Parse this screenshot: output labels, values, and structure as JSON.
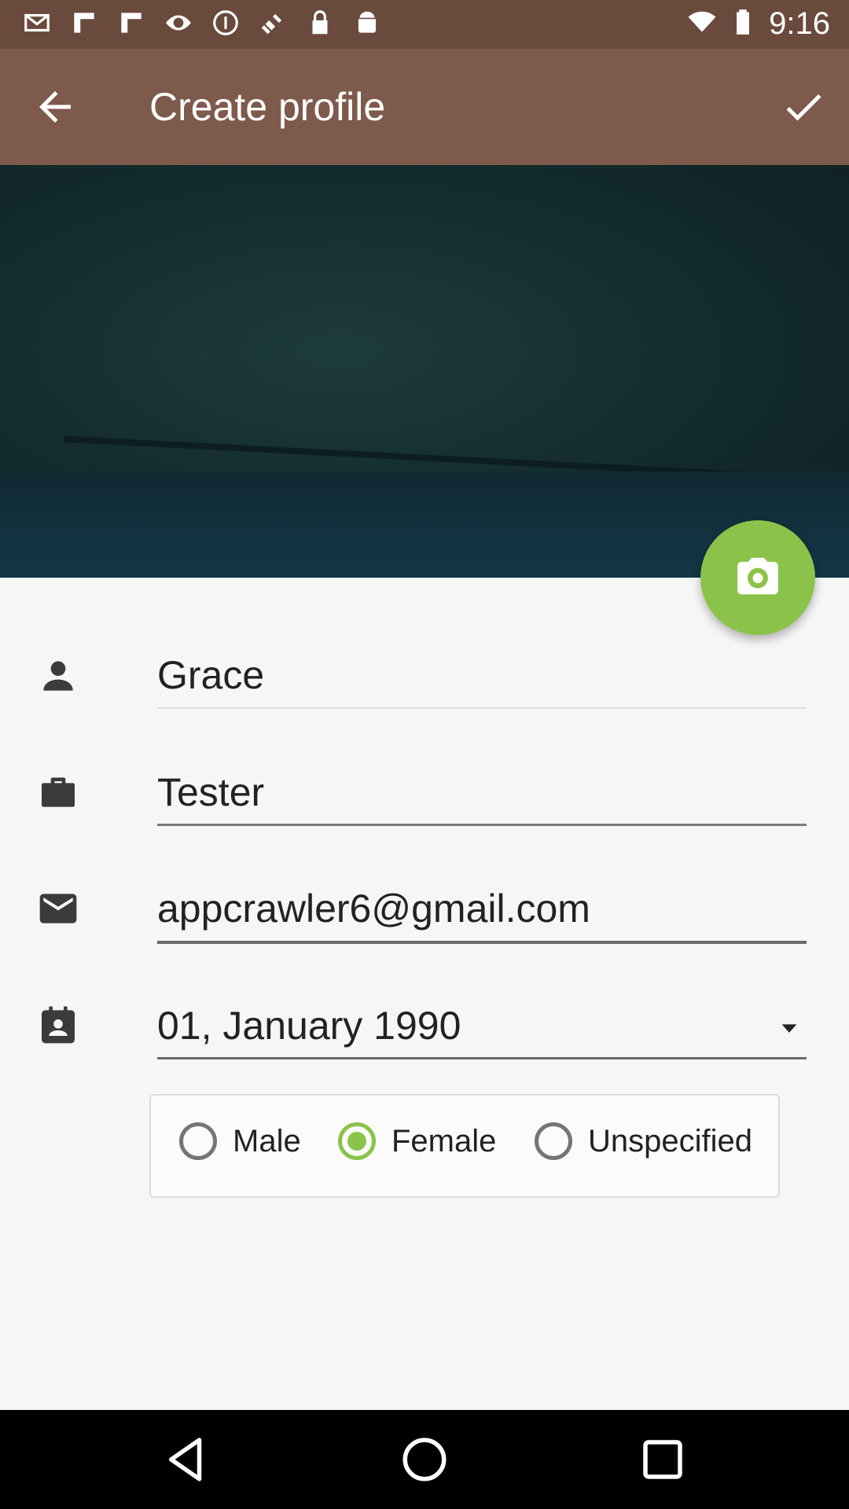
{
  "status_bar": {
    "time": "9:16",
    "icons": [
      "mail-icon",
      "flipboard-icon",
      "flipboard-icon",
      "eye-icon",
      "info-icon",
      "satellite-icon",
      "lock-icon",
      "android-icon",
      "wifi-icon",
      "battery-icon"
    ]
  },
  "app_bar": {
    "title": "Create profile",
    "back_icon": "arrow-back-icon",
    "confirm_icon": "check-icon"
  },
  "photo": {
    "camera_icon": "camera-icon"
  },
  "form": {
    "name": {
      "icon": "person-icon",
      "value": "Grace"
    },
    "occupation": {
      "icon": "briefcase-icon",
      "value": "Tester"
    },
    "email": {
      "icon": "mail-icon",
      "value": "appcrawler6@gmail.com"
    },
    "birthdate": {
      "icon": "contact-calendar-icon",
      "value": "01, January 1990"
    },
    "gender": {
      "options": [
        "Male",
        "Female",
        "Unspecified"
      ],
      "selected": "Female"
    }
  },
  "colors": {
    "status_bar": "#6a4a3c",
    "app_bar": "#7e5a4c",
    "accent": "#8bc34a"
  }
}
